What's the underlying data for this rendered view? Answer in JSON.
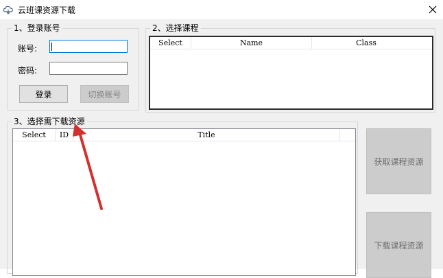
{
  "window": {
    "title": "云班课资源下载"
  },
  "login": {
    "legend": "1、登录账号",
    "account_label": "账号:",
    "password_label": "密码:",
    "account_value": "",
    "password_value": "",
    "login_button": "登录",
    "switch_button": "切换账号"
  },
  "courses": {
    "legend": "2、选择课程",
    "columns": [
      "Select",
      "Name",
      "Class"
    ]
  },
  "resources": {
    "legend": "3、选择需下载资源",
    "columns": [
      "Select",
      "ID",
      "Title"
    ]
  },
  "actions": {
    "fetch_button": "获取课程资源",
    "download_button": "下载课程资源"
  },
  "colors": {
    "annotation_arrow": "#d32f2f",
    "focus": "#0078d7"
  }
}
